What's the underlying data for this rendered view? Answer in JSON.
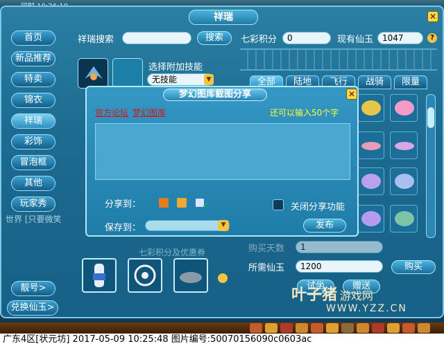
{
  "window": {
    "title": "祥瑞",
    "clock": "卯时 10:26:19"
  },
  "sidebar": {
    "items": [
      {
        "label": "首页"
      },
      {
        "label": "新品推荐"
      },
      {
        "label": "特卖"
      },
      {
        "label": "锦衣"
      },
      {
        "label": "祥瑞"
      },
      {
        "label": "彩饰"
      },
      {
        "label": "冒泡框"
      },
      {
        "label": "其他"
      },
      {
        "label": "玩家秀"
      }
    ],
    "bottom": [
      {
        "label": "靓号>"
      },
      {
        "label": "兑换仙玉>"
      }
    ]
  },
  "search": {
    "label": "祥瑞搜索",
    "value": "",
    "button": "搜索"
  },
  "points": {
    "label": "七彩积分",
    "value": "0"
  },
  "jade": {
    "label": "现有仙玉",
    "value": "1047",
    "help": "?"
  },
  "skill": {
    "label": "选择附加技能",
    "value": "无技能"
  },
  "tabs": [
    {
      "label": "全部"
    },
    {
      "label": "陆地"
    },
    {
      "label": "飞行"
    },
    {
      "label": "战骑"
    },
    {
      "label": "限量"
    }
  ],
  "dialog": {
    "title": "梦幻图库截图分享",
    "links": [
      "官方论坛",
      "梦幻图库"
    ],
    "remaining": "还可以输入50个字",
    "share_to": "分享到：",
    "save_to": "保存到：",
    "close_share": "关闭分享功能",
    "publish": "发布",
    "icons": [
      "share-icon-1",
      "share-icon-2",
      "share-icon-3"
    ]
  },
  "purchase": {
    "price_label": "所需仙玉",
    "price_value": "1200",
    "buy": "购买",
    "give": "赠送",
    "try": "试坐",
    "hidden_label": "购买天数",
    "hidden_value": "1"
  },
  "chat": {
    "line1": "世界 [只要微笑",
    "line2": "七彩积分及优惠券"
  },
  "status_line": "广东4区[状元坊] 2017-05-09 10:25:48 图片编号:50070156090c0603ac",
  "watermark": {
    "brand": "叶子猪",
    "sub": "游戏网",
    "site": "WWW.YZZ.CN"
  },
  "colors": {
    "accent": "#1f7aa6",
    "link": "#d01a1a",
    "note": "#ffff33"
  }
}
